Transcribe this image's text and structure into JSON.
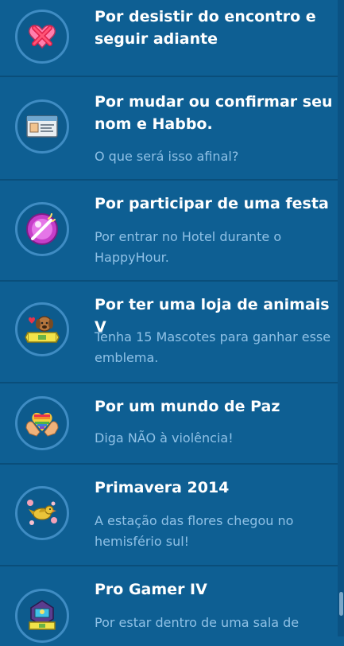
{
  "badges": [
    {
      "title": "Por desistir do encontro e seguir adiante",
      "description": "",
      "icon": "broken-heart-icon"
    },
    {
      "title": "Por mudar ou confirmar seu nom e Habbo.",
      "description": "O que será isso afinal?",
      "icon": "name-card-icon"
    },
    {
      "title": "Por participar de uma festa",
      "description": "Por entrar no Hotel durante o HappyHour.",
      "icon": "party-disco-icon"
    },
    {
      "title": "Por ter uma loja de animais V",
      "description": "Tenha 15 Mascotes para ganhar esse emblema.",
      "icon": "pet-shop-icon"
    },
    {
      "title": "Por um mundo de Paz",
      "description": "Diga NÃO à violência!",
      "icon": "rainbow-heart-hands-icon"
    },
    {
      "title": "Primavera 2014",
      "description": "A estação das flores chegou no hemisfério sul!",
      "icon": "spring-bird-icon"
    },
    {
      "title": "Pro Gamer IV",
      "description": "Por estar dentro de uma sala de",
      "icon": "pro-gamer-icon"
    }
  ],
  "colors": {
    "background": "#0e5f93",
    "title": "#ffffff",
    "description": "#8fc1e6",
    "ring": "#3f8cc3"
  }
}
